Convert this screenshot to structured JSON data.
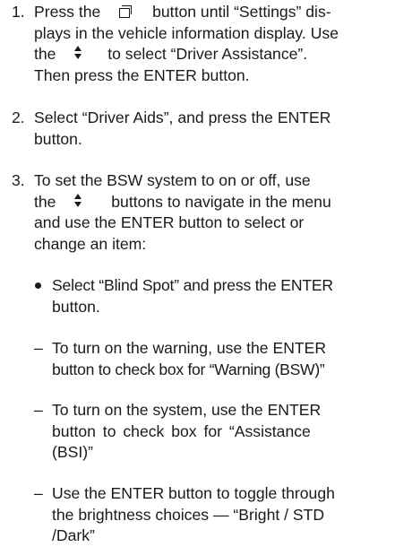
{
  "steps": [
    {
      "number": "1.",
      "line1_a": "Press the",
      "line1_b": "button until “Settings” dis-",
      "line2": "plays in the vehicle information display. Use",
      "line3_a": "the",
      "line3_b": "to select “Driver Assistance”.",
      "line4": "Then press the ENTER button."
    },
    {
      "number": "2.",
      "line1": "Select “Driver Aids”, and press the ENTER",
      "line2": "button."
    },
    {
      "number": "3.",
      "line1": "To set the BSW system to on or off, use",
      "line2_a": "the",
      "line2_b": "buttons to navigate in the menu",
      "line3": "and use the ENTER button to select or",
      "line4": "change an item:"
    }
  ],
  "bullet": {
    "line1": "Select “Blind Spot” and press the ENTER",
    "line2": "button."
  },
  "dashes": [
    {
      "line1": "To turn on the warning, use the ENTER",
      "line2": "button to check box for “Warning (BSW)”"
    },
    {
      "line1": "To turn on the system, use the ENTER",
      "line2": "button to check box for “Assistance",
      "line3": "(BSI)”"
    },
    {
      "line1": "Use the ENTER button to toggle through",
      "line2": "the brightness choices — “Bright / STD",
      "line3": "/Dark”"
    }
  ],
  "dash_mark": "–",
  "icons": {
    "display_button": "display-screen-icon",
    "updown_buttons": "up-down-arrows-icon"
  }
}
